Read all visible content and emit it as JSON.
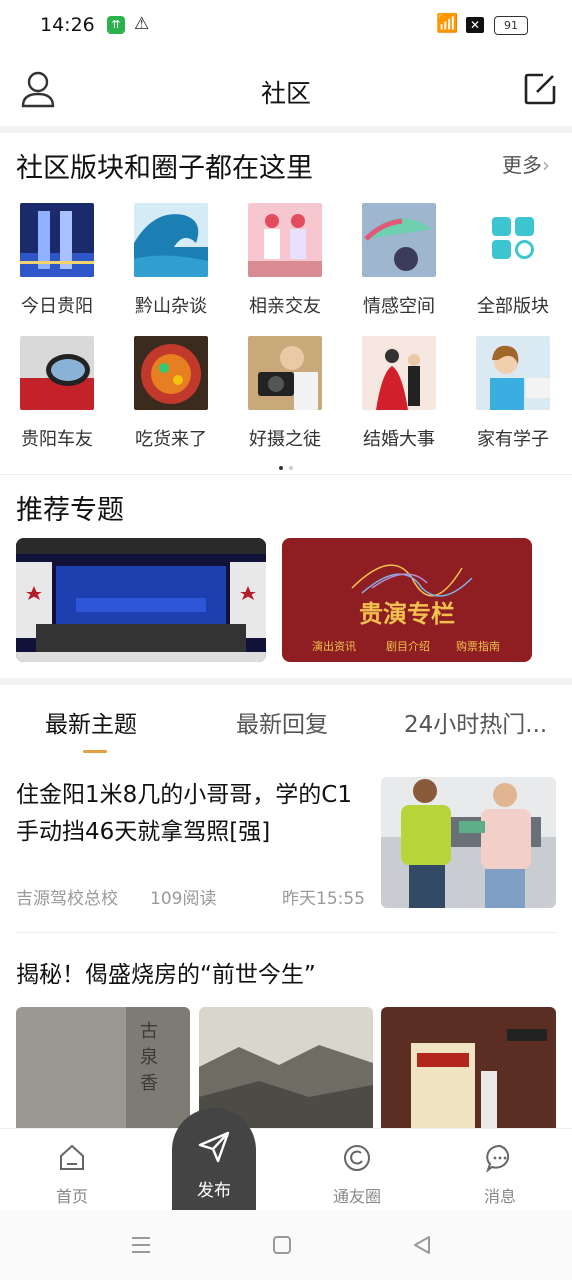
{
  "status_bar": {
    "time": "14:26",
    "battery": "91"
  },
  "header": {
    "title": "社区"
  },
  "forums": {
    "title": "社区版块和圈子都在这里",
    "more": "更多",
    "items": [
      {
        "label": "今日贵阳",
        "icon": "city-towers-thumb"
      },
      {
        "label": "黔山杂谈",
        "icon": "wave-thumb"
      },
      {
        "label": "相亲交友",
        "icon": "couple-thumb"
      },
      {
        "label": "情感空间",
        "icon": "umbrella-thumb"
      },
      {
        "label": "全部版块",
        "icon": "grid-blocks-icon"
      },
      {
        "label": "贵阳车友",
        "icon": "car-mirror-thumb"
      },
      {
        "label": "吃货来了",
        "icon": "food-thumb"
      },
      {
        "label": "好摄之徒",
        "icon": "camera-thumb"
      },
      {
        "label": "结婚大事",
        "icon": "wedding-thumb"
      },
      {
        "label": "家有学子",
        "icon": "student-thumb"
      }
    ]
  },
  "topics": {
    "title": "推荐专题",
    "banner2": {
      "title": "贵演专栏",
      "links": [
        "演出资讯",
        "剧目介绍",
        "购票指南"
      ]
    }
  },
  "feed_tabs": [
    "最新主题",
    "最新回复",
    "24小时热门..."
  ],
  "posts": [
    {
      "title": "住金阳1米8几的小哥哥，学的C1手动挡46天就拿驾照[强]",
      "author": "吉源驾校总校",
      "reads": "109阅读",
      "time": "昨天15:55"
    },
    {
      "title": "揭秘！偈盛烧房的“前世今生”"
    }
  ],
  "tabbar": {
    "home": "首页",
    "publish": "发布",
    "friends": "通友圈",
    "messages": "消息"
  },
  "colors": {
    "accent": "#e0a040",
    "banner_red": "#8e1e22",
    "gold": "#f2c14e"
  }
}
